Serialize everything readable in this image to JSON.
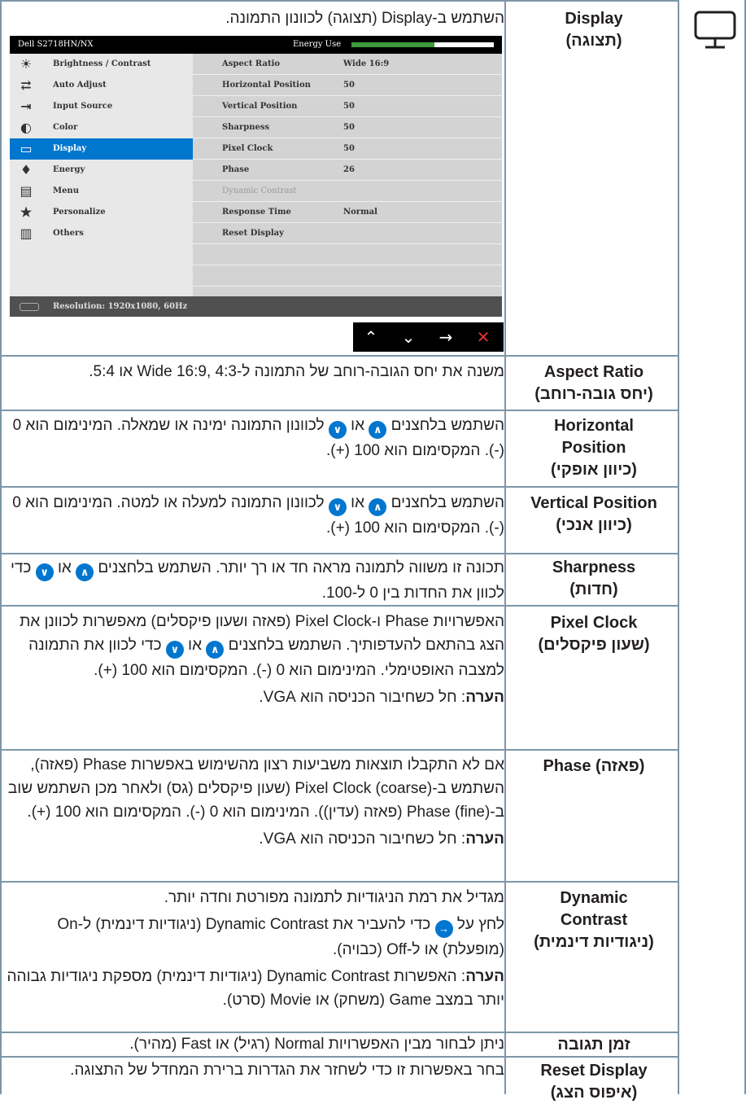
{
  "osd": {
    "model": "Dell S2718HN/NX",
    "energy_label": "Energy Use",
    "energy_level": 0.58,
    "menu": [
      {
        "label": "Brightness / Contrast",
        "icon": "sun-icon"
      },
      {
        "label": "Auto Adjust",
        "icon": "auto-adjust-icon"
      },
      {
        "label": "Input Source",
        "icon": "input-source-icon"
      },
      {
        "label": "Color",
        "icon": "color-icon"
      },
      {
        "label": "Display",
        "icon": "display-icon"
      },
      {
        "label": "Energy",
        "icon": "energy-icon"
      },
      {
        "label": "Menu",
        "icon": "menu-icon"
      },
      {
        "label": "Personalize",
        "icon": "star-icon"
      },
      {
        "label": "Others",
        "icon": "others-icon"
      }
    ],
    "selected_menu": "Display",
    "settings": [
      {
        "key": "Aspect Ratio",
        "value": "Wide 16:9"
      },
      {
        "key": "Horizontal Position",
        "value": "50"
      },
      {
        "key": "Vertical Position",
        "value": "50"
      },
      {
        "key": "Sharpness",
        "value": "50"
      },
      {
        "key": "Pixel Clock",
        "value": "50"
      },
      {
        "key": "Phase",
        "value": "26"
      },
      {
        "key": "Dynamic Contrast",
        "value": ""
      },
      {
        "key": "Response Time",
        "value": "Normal"
      },
      {
        "key": "Reset Display",
        "value": ""
      }
    ],
    "footer": "Resolution: 1920x1080, 60Hz",
    "buttons": [
      "up-icon",
      "down-icon",
      "right-icon",
      "close-icon"
    ]
  },
  "rows": [
    {
      "name": "Display\n(תצוגה)",
      "desc": "השתמש ב-Display (תצוגה) לכוונון התמונה."
    },
    {
      "name": "Aspect Ratio\n(יחס גובה-רוחב)",
      "desc": "משנה את יחס הגובה-רוחב של התמונה ל-Wide 16:9, 4:3 או 5:4."
    },
    {
      "name": "Horizontal\nPosition\n(כיוון אופקי)",
      "desc_a": "השתמש בלחצנים",
      "desc_or": "או",
      "desc_b": "לכוונון התמונה ימינה או שמאלה. המינימום הוא 0 (-). המקסימום הוא 100 (+)."
    },
    {
      "name": "Vertical Position\n(כיוון אנכי)",
      "desc_a": "השתמש בלחצנים",
      "desc_or": "או",
      "desc_b": "לכוונון התמונה למעלה או למטה. המינימום הוא 0 (-). המקסימום הוא 100 (+)."
    },
    {
      "name": "Sharpness\n(חדות)",
      "desc_a": "תכונה זו משווה לתמונה מראה חד או רך יותר. השתמש בלחצנים",
      "desc_or": "או",
      "desc_b": "כדי לכוון את החדות בין 0 ל-100."
    },
    {
      "name": "Pixel Clock\n(שעון פיקסלים)",
      "desc_a": "האפשרויות Phase ו-Pixel Clock (פאזה ושעון פיקסלים) מאפשרות לכוונן את הצג בהתאם להעדפותיך. השתמש בלחצנים",
      "desc_or": "או",
      "desc_b": "כדי לכוון את התמונה למצבה האופטימלי. המינימום הוא 0 (-). המקסימום הוא 100 (+).",
      "note_label": "הערה",
      "note": ": חל כשחיבור הכניסה הוא VGA."
    },
    {
      "name": "Phase (פאזה)",
      "desc": "אם לא התקבלו תוצאות משביעות רצון מהשימוש באפשרות Phase (פאזה), השתמש ב-Pixel Clock (coarse) (שעון פיקסלים (גס) ולאחר מכן השתמש שוב ב-Phase (fine) (פאזה (עדין)). המינימום הוא 0 (-). המקסימום הוא 100 (+).",
      "note_label": "הערה",
      "note": ": חל כשחיבור הכניסה הוא VGA."
    },
    {
      "name": "Dynamic\nContrast\n(ניגודיות דינמית)",
      "desc": "מגדיל את רמת הניגודיות לתמונה מפורטת וחדה יותר.",
      "desc2_a": "לחץ על",
      "desc2_b": "כדי להעביר את Dynamic Contrast (ניגודיות דינמית) ל-On (מופעלת) או ל-Off (כבויה).",
      "note_label": "הערה",
      "note": ": האפשרות Dynamic Contrast (ניגודיות דינמית) מספקת ניגודיות גבוהה יותר במצב Game (משחק) או Movie (סרט)."
    },
    {
      "name": "זמן תגובה",
      "desc": "ניתן לבחור מבין האפשרויות Normal (רגיל) או Fast (מהיר)."
    },
    {
      "name": "Reset Display\n(איפוס הצג)",
      "desc": "בחר באפשרות זו כדי לשחזר את הגדרות ברירת המחדל של התצוגה."
    }
  ]
}
